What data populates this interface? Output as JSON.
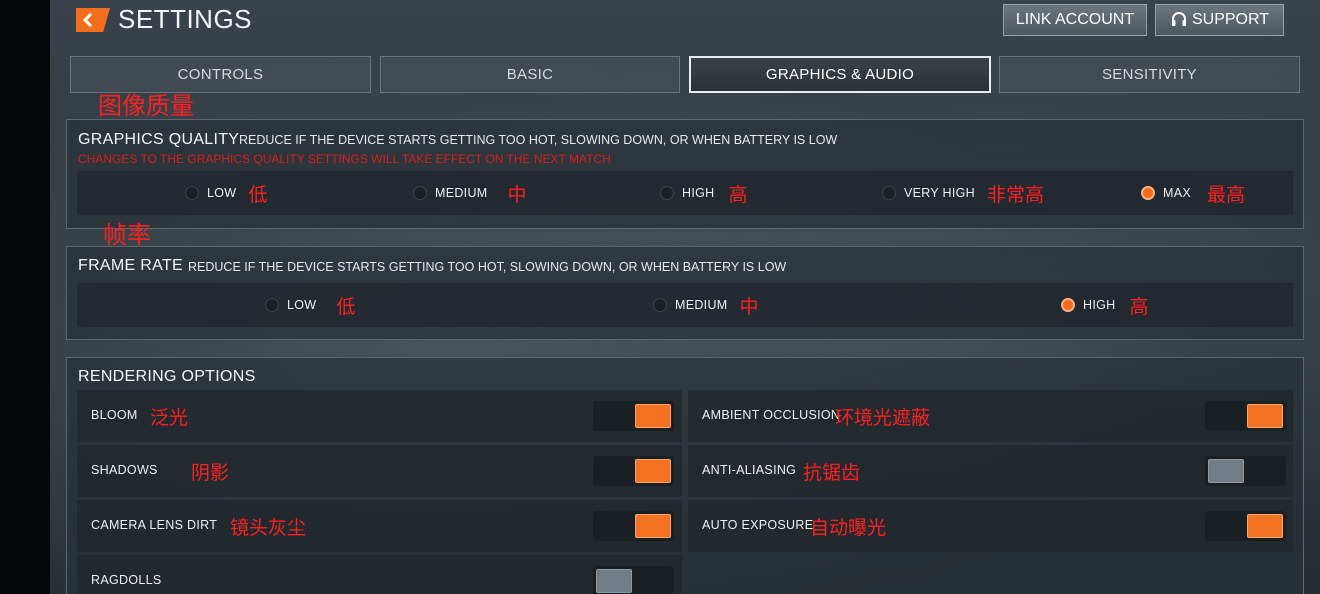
{
  "header": {
    "title": "SETTINGS",
    "link_account": "LINK ACCOUNT",
    "support": "SUPPORT"
  },
  "tabs": [
    {
      "label": "CONTROLS",
      "active": false
    },
    {
      "label": "BASIC",
      "active": false
    },
    {
      "label": "GRAPHICS & AUDIO",
      "active": true
    },
    {
      "label": "SENSITIVITY",
      "active": false
    }
  ],
  "graphics_quality": {
    "annotation": "图像质量",
    "title": "GRAPHICS QUALITY",
    "description": "REDUCE IF THE DEVICE STARTS GETTING TOO HOT, SLOWING DOWN, OR WHEN BATTERY IS LOW",
    "warning": "CHANGES TO THE GRAPHICS QUALITY SETTINGS WILL TAKE EFFECT ON THE NEXT MATCH",
    "options": [
      {
        "label": "LOW",
        "annotation": "低",
        "selected": false
      },
      {
        "label": "MEDIUM",
        "annotation": "中",
        "selected": false
      },
      {
        "label": "HIGH",
        "annotation": "高",
        "selected": false
      },
      {
        "label": "VERY HIGH",
        "annotation": "非常高",
        "selected": false
      },
      {
        "label": "MAX",
        "annotation": "最高",
        "selected": true
      }
    ]
  },
  "frame_rate": {
    "annotation": "帧率",
    "title": "FRAME RATE",
    "description": "REDUCE IF THE DEVICE STARTS GETTING TOO HOT, SLOWING DOWN, OR WHEN BATTERY IS LOW",
    "options": [
      {
        "label": "LOW",
        "annotation": "低",
        "selected": false
      },
      {
        "label": "MEDIUM",
        "annotation": "中",
        "selected": false
      },
      {
        "label": "HIGH",
        "annotation": "高",
        "selected": true
      }
    ]
  },
  "rendering": {
    "title": "RENDERING OPTIONS",
    "left": [
      {
        "label": "BLOOM",
        "annotation": "泛光",
        "on": true
      },
      {
        "label": "SHADOWS",
        "annotation": "阴影",
        "on": true
      },
      {
        "label": "CAMERA LENS DIRT",
        "annotation": "镜头灰尘",
        "on": true
      },
      {
        "label": "RAGDOLLS",
        "annotation": "",
        "on": false
      }
    ],
    "right": [
      {
        "label": "AMBIENT OCCLUSION",
        "annotation": "环境光遮蔽",
        "on": true
      },
      {
        "label": "ANTI-ALIASING",
        "annotation": "抗锯齿",
        "on": false
      },
      {
        "label": "AUTO EXPOSURE",
        "annotation": "自动曝光",
        "on": true
      }
    ]
  },
  "colors": {
    "accent": "#f26a1e",
    "annotation": "#ff2020",
    "warning": "#d52020"
  },
  "icons": {
    "back": "back-chevron-icon",
    "support": "headset-icon"
  }
}
